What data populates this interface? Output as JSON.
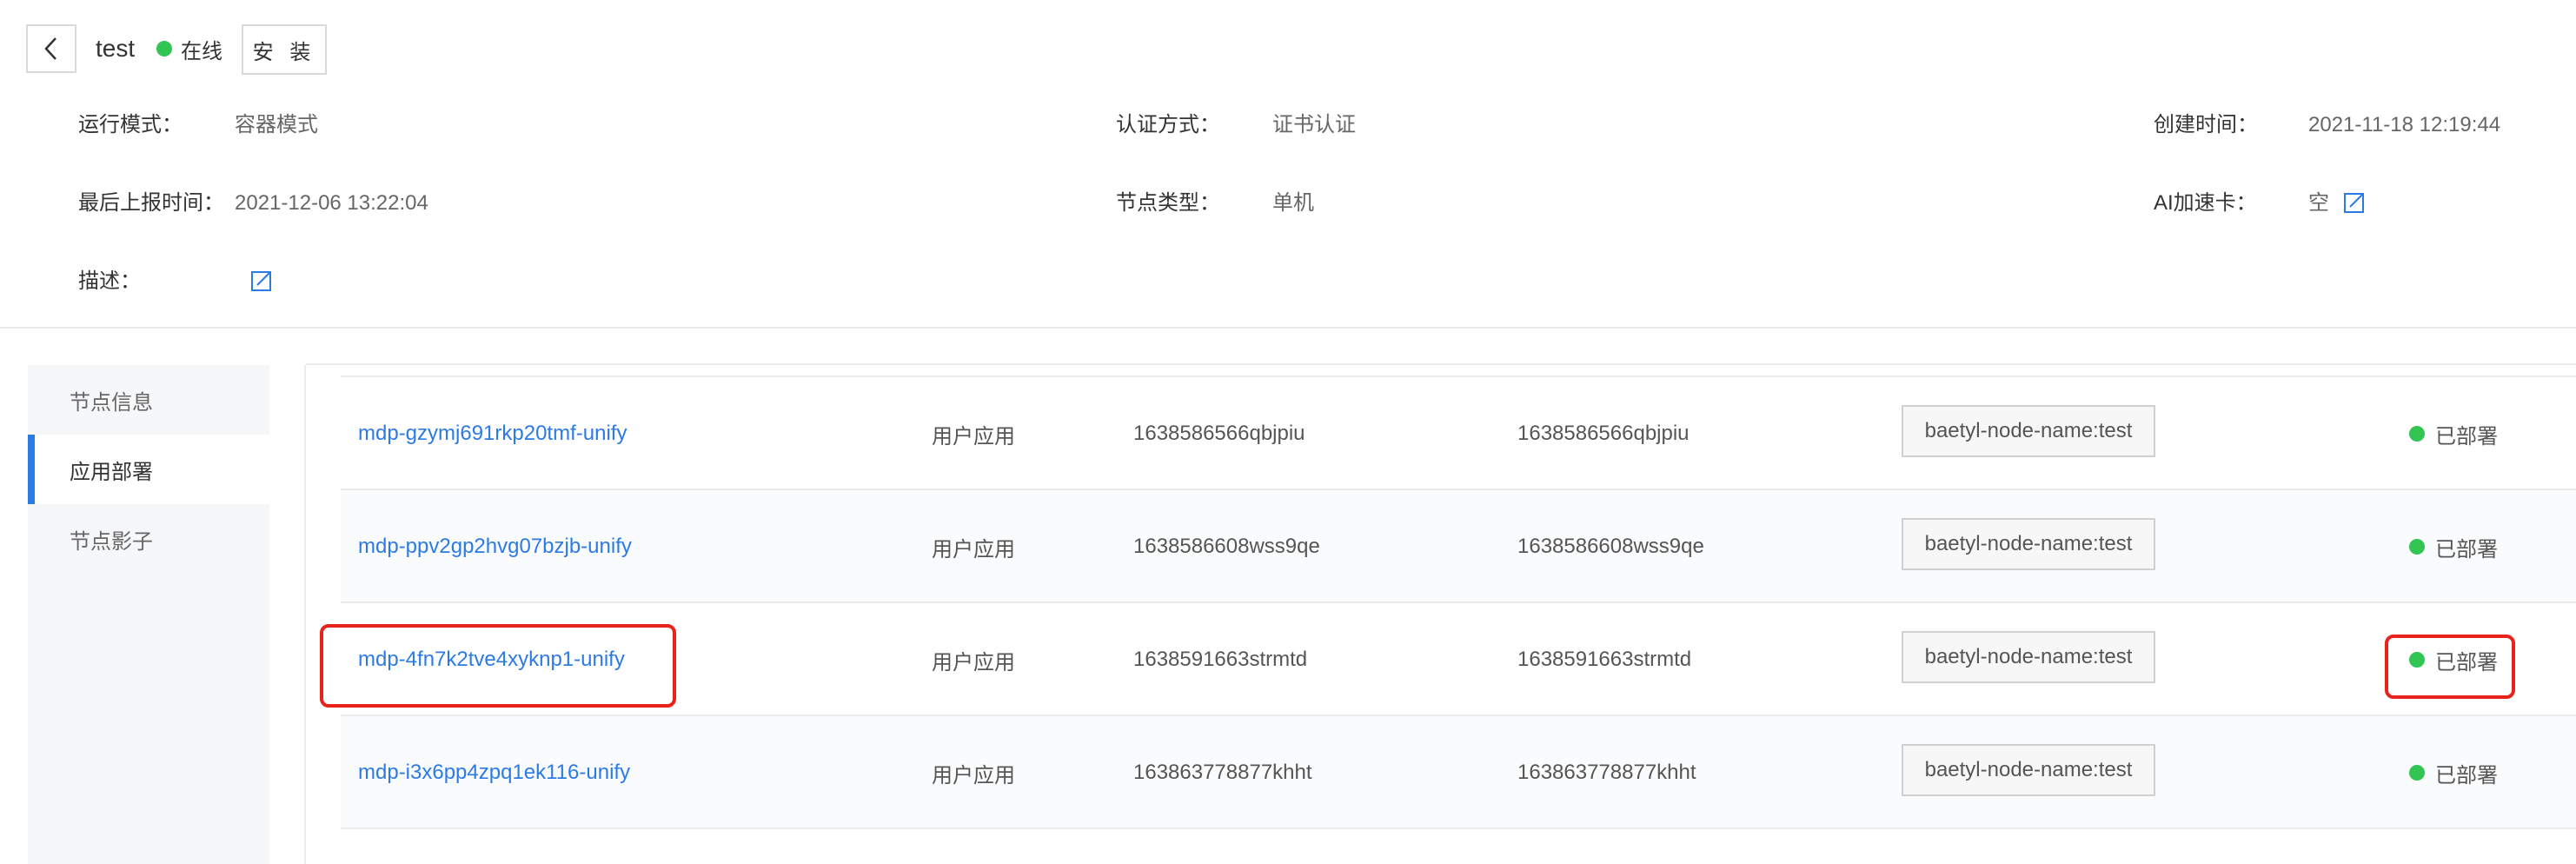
{
  "header": {
    "node_name": "test",
    "status": "在线",
    "install_label": "安 装"
  },
  "info": {
    "run_mode_label": "运行模式：",
    "run_mode_value": "容器模式",
    "auth_label": "认证方式：",
    "auth_value": "证书认证",
    "created_label": "创建时间：",
    "created_value": "2021-11-18 12:19:44",
    "last_report_label": "最后上报时间：",
    "last_report_value": "2021-12-06 13:22:04",
    "node_type_label": "节点类型：",
    "node_type_value": "单机",
    "ai_card_label": "AI加速卡：",
    "ai_card_value": "空",
    "desc_label": "描述："
  },
  "sidebar": {
    "items": [
      {
        "label": "节点信息"
      },
      {
        "label": "应用部署"
      },
      {
        "label": "节点影子"
      }
    ]
  },
  "table": {
    "rows": [
      {
        "name": "mdp-gzymj691rkp20tmf-unify",
        "type": "用户应用",
        "version": "1638586566qbjpiu",
        "config": "1638586566qbjpiu",
        "selector": "baetyl-node-name:test",
        "status": "已部署"
      },
      {
        "name": "mdp-ppv2gp2hvg07bzjb-unify",
        "type": "用户应用",
        "version": "1638586608wss9qe",
        "config": "1638586608wss9qe",
        "selector": "baetyl-node-name:test",
        "status": "已部署"
      },
      {
        "name": "mdp-4fn7k2tve4xyknp1-unify",
        "type": "用户应用",
        "version": "1638591663strmtd",
        "config": "1638591663strmtd",
        "selector": "baetyl-node-name:test",
        "status": "已部署"
      },
      {
        "name": "mdp-i3x6pp4zpq1ek116-unify",
        "type": "用户应用",
        "version": "163863778877khht",
        "config": "163863778877khht",
        "selector": "baetyl-node-name:test",
        "status": "已部署"
      }
    ]
  },
  "colors": {
    "accent": "#2c7be5",
    "online": "#32c553",
    "highlight": "#e8231c"
  }
}
